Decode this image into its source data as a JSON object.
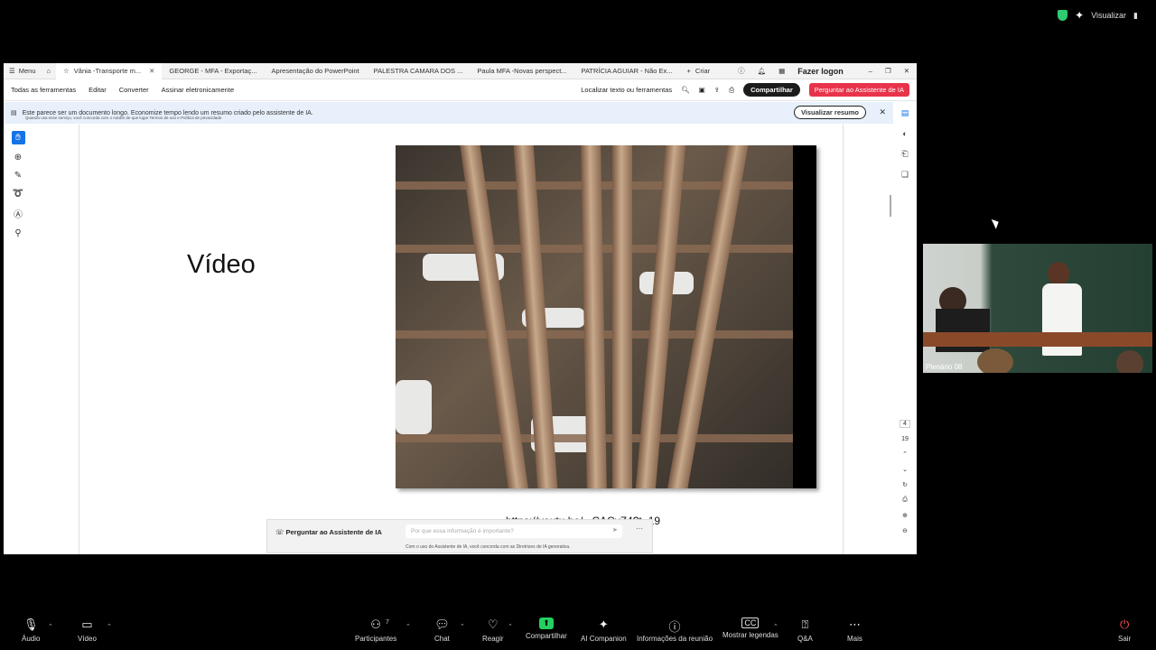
{
  "zoom_top": {
    "view_label": "Visualizar"
  },
  "acrobat": {
    "menu_label": "Menu",
    "tabs": [
      {
        "label": "Vânia -Transporte m...",
        "active": true
      },
      {
        "label": "GEORGE - MFA - Exportaç..."
      },
      {
        "label": "Apresentação do PowerPoint"
      },
      {
        "label": "PALESTRA CAMARA DOS ..."
      },
      {
        "label": "Paula MFA -Novas perspect..."
      },
      {
        "label": "PATRÍCIA AGUIAR - Não Ex..."
      }
    ],
    "new_tab_label": "Criar",
    "logon_label": "Fazer logon",
    "toolbar": {
      "all_tools": "Todas as ferramentas",
      "edit": "Editar",
      "convert": "Converter",
      "sign": "Assinar eletronicamente",
      "find": "Localizar texto ou ferramentas",
      "share": "Compartilhar",
      "ask_ai": "Perguntar ao Assistente de IA"
    },
    "banner": {
      "text": "Este parece ser um documento longo. Economize tempo lendo um resumo criado pelo assistente de IA.",
      "subtext": "Quando usa esse serviço, você concorda com o Adobe de que lugar Termos de uso e Política de privacidade",
      "button": "Visualizar resumo"
    },
    "slide": {
      "title": "Vídeo",
      "url": "https://youtu.be/...CACyZ4?t=19"
    },
    "ai_box": {
      "label": "Perguntar ao Assistente de IA",
      "placeholder": "Por que essa informação é importante?",
      "fine_print": "Com o uso do Assistente de IA, você concorda com as Diretrizes de IA generativa."
    },
    "page_nav": {
      "current": "4",
      "total": "19"
    }
  },
  "speaker": {
    "name": "Plenário 08"
  },
  "bottombar": {
    "audio": "Áudio",
    "video": "Vídeo",
    "participants": "Participantes",
    "participants_count": "7",
    "chat": "Chat",
    "react": "Reagir",
    "share": "Compartilhar",
    "ai": "AI Companion",
    "info": "Informações da reunião",
    "captions": "Mostrar legendas",
    "qa": "Q&A",
    "more": "Mais",
    "leave": "Sair"
  }
}
